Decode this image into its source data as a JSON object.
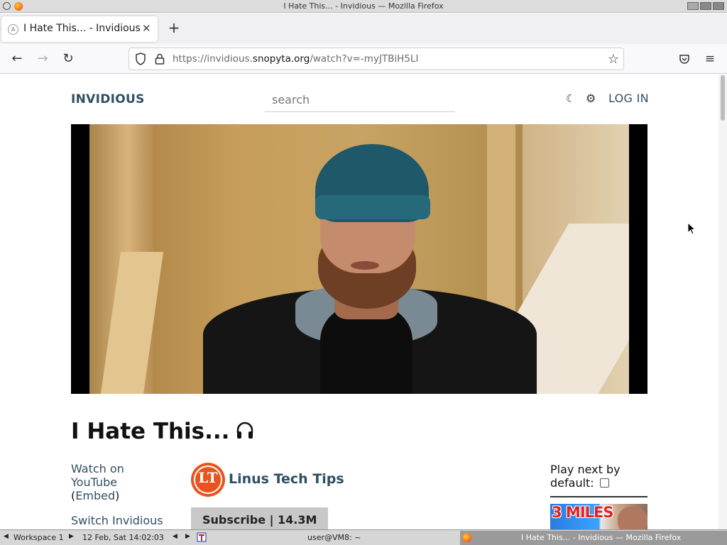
{
  "window": {
    "title": "I Hate This... - Invidious — Mozilla Firefox"
  },
  "browser": {
    "tab_title": "I Hate This... - Invidious",
    "url_prefix": "https://invidious.",
    "url_host": "snopyta.org",
    "url_path": "/watch?v=-myJTBiH5LI"
  },
  "site": {
    "logo": "INVIDIOUS",
    "search_placeholder": "search",
    "login_label": "LOG IN"
  },
  "video": {
    "title": "I Hate This...",
    "watch_on_label": "Watch on YouTube",
    "embed_label": "Embed",
    "switch_label": "Switch Invidious"
  },
  "channel": {
    "name": "Linus Tech Tips",
    "logo_text": "LT",
    "subscribe_label": "Subscribe | 14.3M"
  },
  "sidebar": {
    "play_next_label": "Play next by default:",
    "play_next_checked": false,
    "thumb_text": "3 MILES"
  },
  "taskbar": {
    "workspace": "Workspace 1",
    "datetime": "12 Feb, Sat 14:02:03",
    "terminal": "user@VM8: ~",
    "task_title": "I Hate This... - Invidious — Mozilla Firefox"
  }
}
